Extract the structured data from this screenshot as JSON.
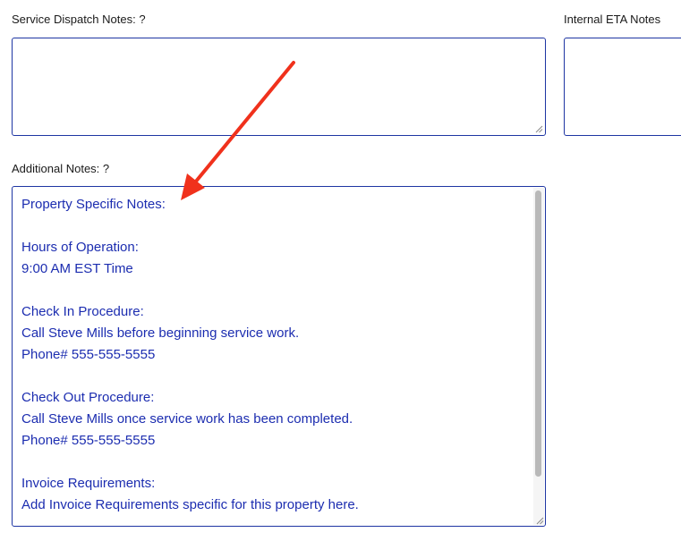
{
  "fields": {
    "service_dispatch": {
      "label": "Service Dispatch Notes: ?",
      "value": ""
    },
    "internal_eta": {
      "label": "Internal ETA Notes",
      "value": ""
    },
    "additional": {
      "label": "Additional Notes: ?",
      "lines": [
        "Property Specific Notes:",
        "",
        "Hours of Operation:",
        "9:00 AM EST Time",
        "",
        "Check In Procedure:",
        "Call Steve Mills before beginning service work.",
        "Phone# 555-555-5555",
        "",
        "Check Out Procedure:",
        "Call Steve Mills once service work has been completed.",
        "Phone# 555-555-5555",
        "",
        "Invoice Requirements:",
        "Add Invoice Requirements specific for this property here."
      ]
    }
  },
  "annotation": {
    "icon": "red-arrow-icon",
    "color": "#f0311c"
  },
  "colors": {
    "field_border": "#1e35a3",
    "notes_text": "#1c2db0"
  }
}
